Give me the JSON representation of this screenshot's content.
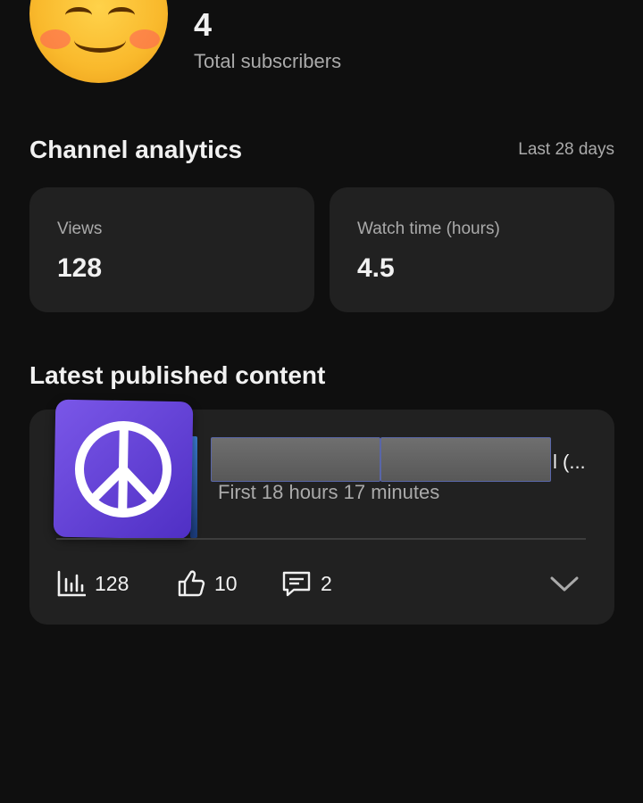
{
  "header": {
    "subscriber_count": "4",
    "subscriber_label": "Total subscribers"
  },
  "analytics": {
    "title": "Channel analytics",
    "range": "Last 28 days",
    "cards": [
      {
        "label": "Views",
        "value": "128"
      },
      {
        "label": "Watch time (hours)",
        "value": "4.5"
      }
    ]
  },
  "latest": {
    "title": "Latest published content",
    "item": {
      "title_visible_tail": "l (...",
      "published": "First 18 hours 17 minutes",
      "views": "128",
      "likes": "10",
      "comments": "2"
    }
  },
  "icons": {
    "avatar": "smiling-face-emoji",
    "thumbnail": "peace-sign",
    "views": "bar-chart-icon",
    "likes": "thumbs-up-icon",
    "comments": "comment-icon",
    "expand": "chevron-down-icon"
  },
  "colors": {
    "background": "#0f0f0f",
    "card": "#212121",
    "secondary_text": "#aaaaaa",
    "thumbnail_purple": "#6a46dc"
  }
}
